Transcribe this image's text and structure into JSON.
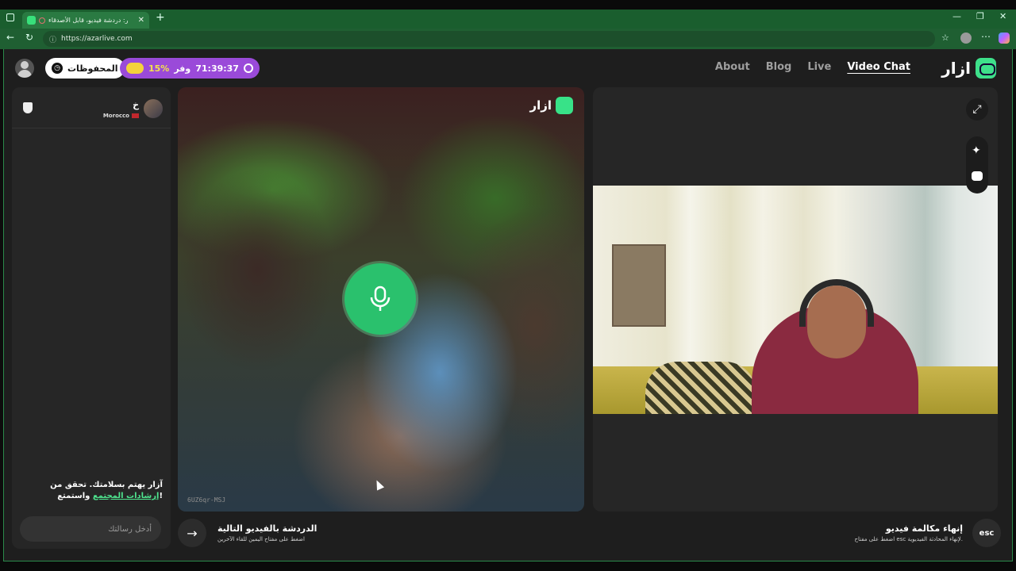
{
  "browser": {
    "tab_title": "آزار: دردشة فيديو، قابل الأصدقاء",
    "url": "https://azarlive.com"
  },
  "header": {
    "saved_label": "المحفوظات",
    "promo_timer": "71:39:37",
    "promo_text": "وفر",
    "promo_percent": "15%",
    "nav": [
      "About",
      "Blog",
      "Live",
      "Video Chat"
    ],
    "logo_text": "ازار"
  },
  "chat": {
    "peer_name": "خ",
    "peer_country": "Morocco",
    "safety_text": "آزار يهتم بسلامتك. تحقق من",
    "safety_link": "إرشادات المجتمع",
    "safety_suffix": "واستمتع!",
    "input_placeholder": "أدخل رسالتك"
  },
  "remote": {
    "watermark": "ازار",
    "code": "6UZ6qr-MSJ"
  },
  "actions": {
    "next_title": "الدردشة بالفيديو التالية",
    "next_sub": "اضغط على مفتاح اليمين للقاء الآخرين",
    "end_title": "إنهاء مكالمة فيديو",
    "end_sub": "اضغط على مفتاح esc لإنهاء المحادثة الفيديوية.",
    "esc_label": "esc"
  },
  "colors": {
    "accent_green": "#3ee08a",
    "promo_purple": "#9a4ad9"
  }
}
